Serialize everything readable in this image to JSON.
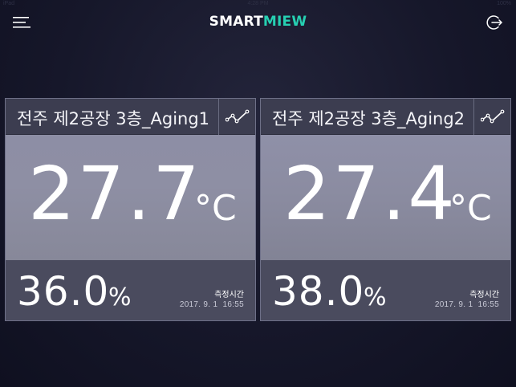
{
  "status_bar": {
    "carrier": "iPad",
    "time": "4:28 PM",
    "battery": "100%"
  },
  "header": {
    "logo_part1": "SMART",
    "logo_part2": "MIEW",
    "logo_color_1": "#ffffff",
    "logo_color_2": "#26d0b2",
    "menu_icon": "hamburger-menu-icon",
    "logout_icon": "logout-icon"
  },
  "cards": [
    {
      "title": "전주 제2공장 3층_Aging1",
      "temperature": "27.7",
      "temp_unit": "°C",
      "humidity": "36.0",
      "humidity_unit": "%",
      "measure_label": "측정시간",
      "measure_time": "2017. 9. 1  16:55",
      "graph_icon": "line-chart-icon"
    },
    {
      "title": "전주 제2공장 3층_Aging2",
      "temperature": "27.4",
      "temp_unit": "°C",
      "humidity": "38.0",
      "humidity_unit": "%",
      "measure_label": "측정시간",
      "measure_time": "2017. 9. 1  16:55",
      "graph_icon": "line-chart-icon"
    }
  ]
}
